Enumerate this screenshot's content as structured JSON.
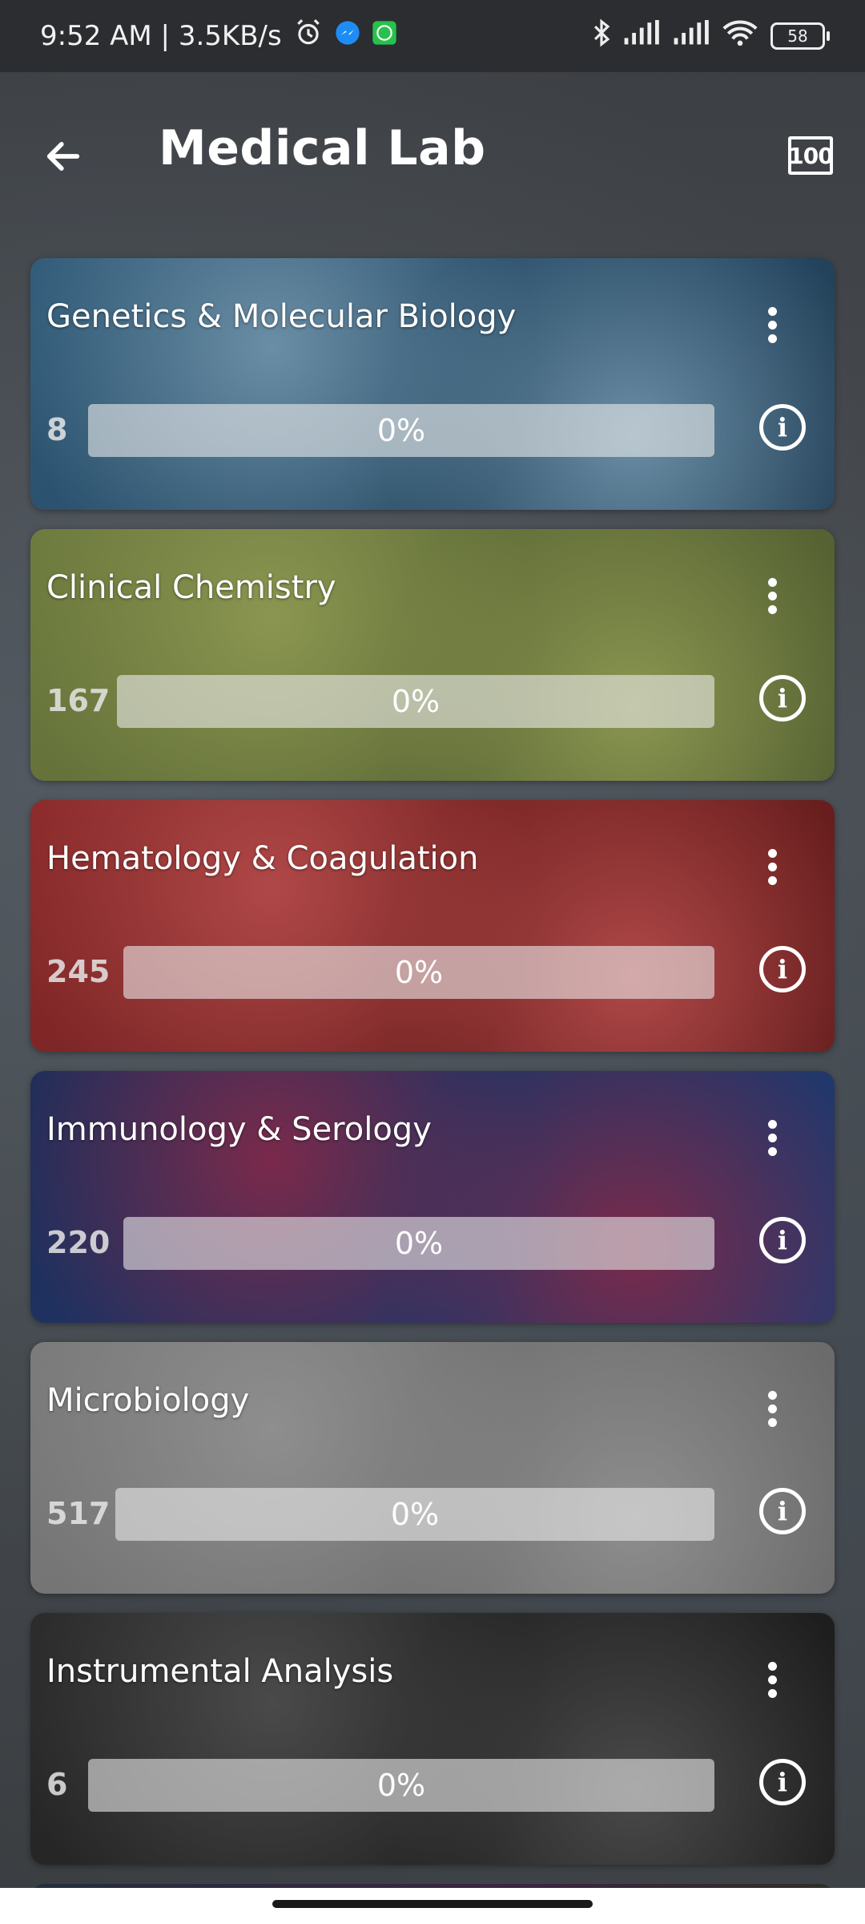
{
  "status_bar": {
    "time_speed": "9:52 AM | 3.5KB/s",
    "battery": "58"
  },
  "header": {
    "title": "Medical Lab",
    "score_icon_text": "100"
  },
  "cards": [
    {
      "title": "Genetics & Molecular Biology",
      "count": "8",
      "progress_text": "0%",
      "progress": 0,
      "colors": [
        "#2f5a78",
        "#6a8ea5",
        "#1f3b52"
      ]
    },
    {
      "title": "Clinical Chemistry",
      "count": "167",
      "progress_text": "0%",
      "progress": 0,
      "colors": [
        "#6d7a3e",
        "#8a9650",
        "#4e5a2e"
      ]
    },
    {
      "title": "Hematology & Coagulation",
      "count": "245",
      "progress_text": "0%",
      "progress": 0,
      "colors": [
        "#8a2a2a",
        "#b04848",
        "#5e1a1a"
      ]
    },
    {
      "title": "Immunology & Serology",
      "count": "220",
      "progress_text": "0%",
      "progress": 0,
      "colors": [
        "#1d2e5a",
        "#7a2a4a",
        "#243a70"
      ]
    },
    {
      "title": "Microbiology",
      "count": "517",
      "progress_text": "0%",
      "progress": 0,
      "colors": [
        "#7a7a7a",
        "#8e8e8e",
        "#666666"
      ]
    },
    {
      "title": "Instrumental Analysis",
      "count": "6",
      "progress_text": "0%",
      "progress": 0,
      "colors": [
        "#2a2a2a",
        "#4a4a4a",
        "#1a1a1a"
      ]
    }
  ]
}
